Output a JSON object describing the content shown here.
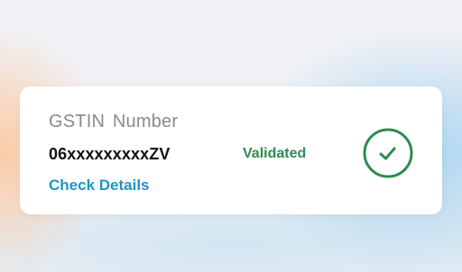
{
  "card": {
    "label": "GSTIN  Number",
    "number": "06xxxxxxxxxZV",
    "status": "Validated",
    "link": "Check Details",
    "icon": "check-circle-icon"
  },
  "colors": {
    "status": "#2e8b4f",
    "link": "#1f95c4",
    "label": "#8a8a8a",
    "check": "#2e8b4f"
  }
}
